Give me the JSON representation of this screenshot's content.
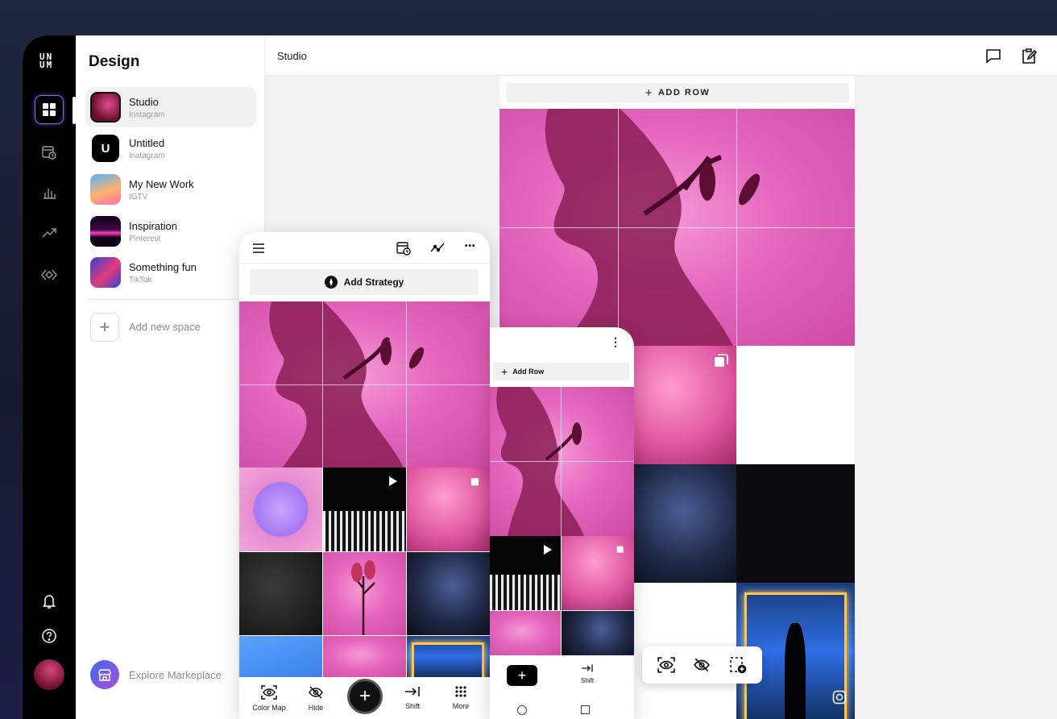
{
  "brand": {
    "logo_top": "UN",
    "logo_bottom": "UM"
  },
  "rail": {
    "items": [
      {
        "name": "grid",
        "icon": "grid-icon",
        "active": true
      },
      {
        "name": "schedule",
        "icon": "calendar-clock-icon"
      },
      {
        "name": "analytics",
        "icon": "bar-chart-icon"
      },
      {
        "name": "trends",
        "icon": "trend-icon"
      },
      {
        "name": "links",
        "icon": "link-diamond-icon"
      }
    ],
    "bottom": [
      {
        "name": "notifications",
        "icon": "bell-icon"
      },
      {
        "name": "help",
        "icon": "help-icon"
      }
    ]
  },
  "sidebar": {
    "title": "Design",
    "spaces": [
      {
        "name": "Studio",
        "platform": "Instagram",
        "active": true
      },
      {
        "name": "Untitled",
        "platform": "Instagram",
        "letter": "U"
      },
      {
        "name": "My New Work",
        "platform": "IGTV"
      },
      {
        "name": "Inspiration",
        "platform": "Pinterest"
      },
      {
        "name": "Something fun",
        "platform": "TikTok"
      }
    ],
    "add_new_space": "Add new space",
    "explore": "Explore Markeplace"
  },
  "header": {
    "breadcrumb": "Studio"
  },
  "grid": {
    "add_row": "ADD ROW"
  },
  "phone_a": {
    "add_strategy": "Add Strategy",
    "more_dots": "•••",
    "bottom": {
      "color_map": "Color Map",
      "hide": "Hide",
      "add": "+",
      "shift": "Shift",
      "more": "More"
    }
  },
  "phone_b": {
    "add_row": "Add Row",
    "menu_dots": "⋮",
    "add": "+",
    "shift": "Shift"
  },
  "colors": {
    "accent": "#7b6cff",
    "pink": "#e566be",
    "rail": "#000000"
  }
}
